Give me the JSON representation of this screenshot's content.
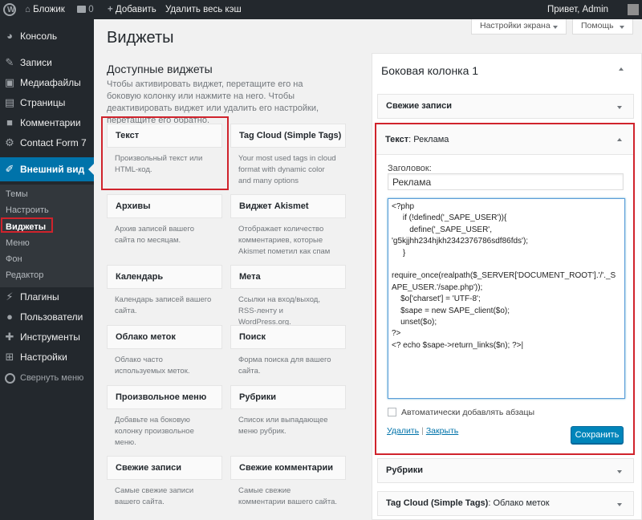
{
  "admin_bar": {
    "site_name": "Бложик",
    "comments_count": "0",
    "add_label": "Добавить",
    "purge_cache_label": "Удалить весь кэш",
    "greeting": "Привет, Admin"
  },
  "menu": {
    "console": "Консоль",
    "posts": "Записи",
    "media": "Медиафайлы",
    "pages": "Страницы",
    "comments": "Комментарии",
    "contact_form": "Contact Form 7",
    "appearance": "Внешний вид",
    "appearance_sub": [
      "Темы",
      "Настроить",
      "Виджеты",
      "Меню",
      "Фон",
      "Редактор"
    ],
    "plugins": "Плагины",
    "users": "Пользователи",
    "tools": "Инструменты",
    "settings": "Настройки",
    "collapse": "Свернуть меню"
  },
  "screen_options": "Настройки экрана",
  "help": "Помощь",
  "page_title": "Виджеты",
  "available": {
    "title": "Доступные виджеты",
    "description": "Чтобы активировать виджет, перетащите его на боковую колонку или нажмите на него. Чтобы деактивировать виджет или удалить его настройки, перетащите его обратно.",
    "widgets": [
      {
        "title": "Текст",
        "desc": "Произвольный текст или HTML-код."
      },
      {
        "title": "Tag Cloud (Simple Tags)",
        "desc": "Your most used tags in cloud format with dynamic color and many options"
      },
      {
        "title": "Архивы",
        "desc": "Архив записей вашего сайта по месяцам."
      },
      {
        "title": "Виджет Akismet",
        "desc": "Отображает количество комментариев, которые Akismet пометил как спам"
      },
      {
        "title": "Календарь",
        "desc": "Календарь записей вашего сайта."
      },
      {
        "title": "Мета",
        "desc": "Ссылки на вход/выход, RSS-ленту и WordPress.org."
      },
      {
        "title": "Облако меток",
        "desc": "Облако часто используемых меток."
      },
      {
        "title": "Поиск",
        "desc": "Форма поиска для вашего сайта."
      },
      {
        "title": "Произвольное меню",
        "desc": "Добавьте на боковую колонку произвольное меню."
      },
      {
        "title": "Рубрики",
        "desc": "Список или выпадающее меню рубрик."
      },
      {
        "title": "Свежие записи",
        "desc": "Самые свежие записи вашего сайта."
      },
      {
        "title": "Свежие комментарии",
        "desc": "Самые свежие комментарии вашего сайта."
      }
    ]
  },
  "sidebar": {
    "title": "Боковая колонка 1",
    "recent_posts": "Свежие записи",
    "open_widget": {
      "name": "Текст",
      "suffix": ": Реклама",
      "title_label": "Заголовок:",
      "title_value": "Реклама",
      "content": "<?php\n     if (!defined('_SAPE_USER')){\n        define('_SAPE_USER', \n'g5kjjhh234hjkh2342376786sdf86fds');\n     }\n\nrequire_once(realpath($_SERVER['DOCUMENT_ROOT'].'/'._S\nAPE_USER.'/sape.php'));\n    $o['charset'] = 'UTF-8';\n    $sape = new SAPE_client($o);\n    unset($o);\n?>\n<? echo $sape->return_links($n); ?>|",
      "autop_label": "Автоматически добавлять абзацы",
      "delete_label": "Удалить",
      "separator": "|",
      "close_label": "Закрыть",
      "save_label": "Сохранить"
    },
    "rubrics": "Рубрики",
    "tagcloud": "Tag Cloud (Simple Tags)",
    "tagcloud_suffix": ": Облако меток"
  },
  "colors": {
    "admin_dark": "#23282d",
    "accent": "#0073aa",
    "highlight": "#d0232c",
    "button": "#0085ba"
  }
}
